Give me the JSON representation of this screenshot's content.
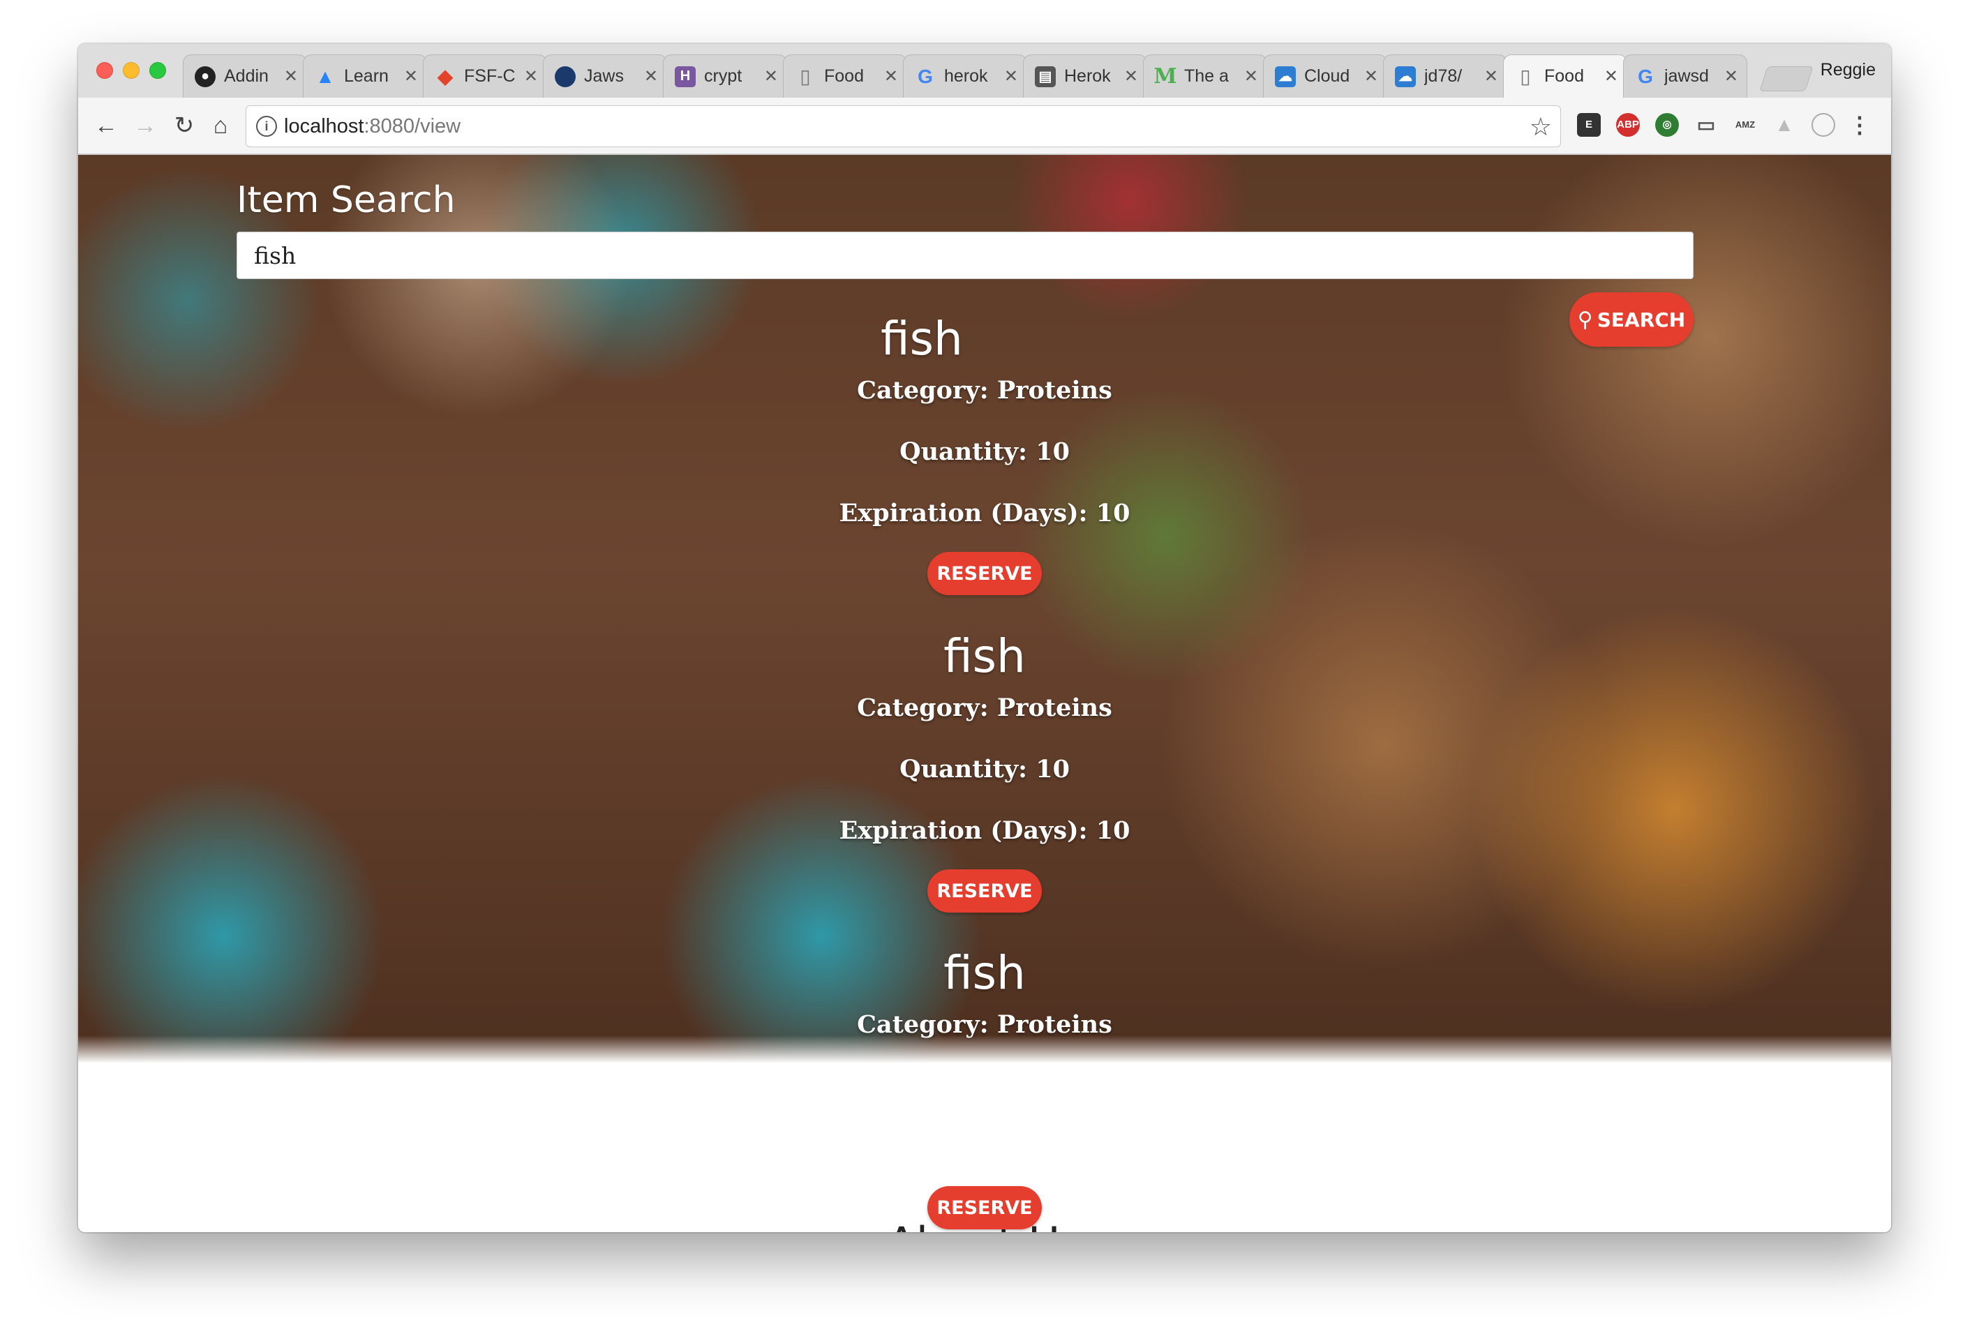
{
  "browser": {
    "tabs": [
      {
        "title": "Addin",
        "icon": "github-icon",
        "color": "#222222"
      },
      {
        "title": "Learn",
        "icon": "atlassian-icon",
        "color": "#2684ff"
      },
      {
        "title": "FSF-C",
        "icon": "gitlab-icon",
        "color": "#e24329"
      },
      {
        "title": "Jaws",
        "icon": "jawsdb-icon",
        "color": "#1a3a6b"
      },
      {
        "title": "crypt",
        "icon": "heroku-icon",
        "color": "#79589f"
      },
      {
        "title": "Food",
        "icon": "page-icon",
        "color": "#888888"
      },
      {
        "title": "herok",
        "icon": "google-icon",
        "color": "#4285f4"
      },
      {
        "title": "Herok",
        "icon": "docs-icon",
        "color": "#555555"
      },
      {
        "title": "The a",
        "icon": "medium-icon",
        "color": "#4caf50"
      },
      {
        "title": "Cloud",
        "icon": "cloud-icon",
        "color": "#2d7dd2"
      },
      {
        "title": "jd78/",
        "icon": "cloud-icon",
        "color": "#2d7dd2"
      },
      {
        "title": "Food",
        "icon": "page-icon",
        "color": "#888888",
        "active": true
      },
      {
        "title": "jawsd",
        "icon": "google-icon",
        "color": "#4285f4"
      }
    ],
    "profile_name": "Reggie",
    "url_host": "localhost",
    "url_rest": ":8080/view"
  },
  "page": {
    "search_title": "Item Search",
    "search_value": "fish",
    "search_button": "SEARCH",
    "results": [
      {
        "name": "fish",
        "category": "Category: Proteins",
        "quantity": "Quantity: 10",
        "expiration": "Expiration (Days): 10",
        "button": "RESERVE"
      },
      {
        "name": "fish",
        "category": "Category: Proteins",
        "quantity": "Quantity: 10",
        "expiration": "Expiration (Days): 10",
        "button": "RESERVE"
      },
      {
        "name": "fish",
        "category": "Category: Proteins",
        "button": "RESERVE"
      }
    ],
    "about_title": "About Us",
    "accent_color": "#e53e2f"
  }
}
